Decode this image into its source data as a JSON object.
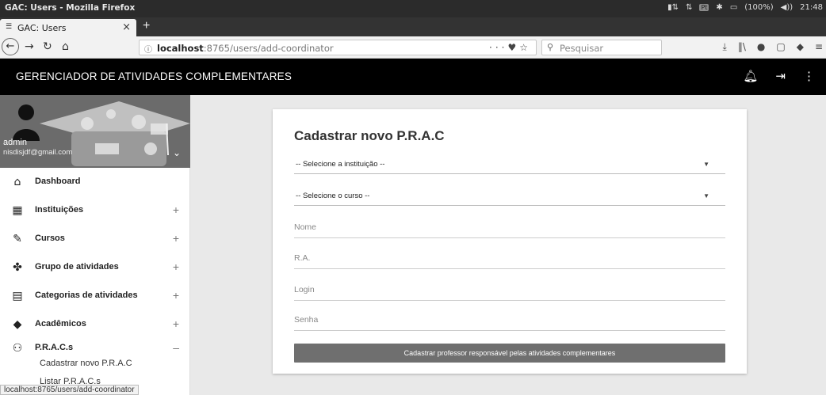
{
  "window": {
    "title": "GAC: Users - Mozilla Firefox"
  },
  "system_tray": {
    "indicator": "Pt",
    "battery": "(100%)",
    "volume_icon": "◀))",
    "clock": "21:48"
  },
  "browser": {
    "tab_label": "GAC: Users",
    "new_tab": "+",
    "url_host": "localhost",
    "url_rest": ":8765/users/add-coordinator",
    "search_placeholder": "Pesquisar",
    "status_link": "localhost:8765/users/add-coordinator"
  },
  "app": {
    "title": "GERENCIADOR DE ATIVIDADES COMPLEMENTARES"
  },
  "profile": {
    "name": "admin",
    "email": "nisdisjdf@gmail.com"
  },
  "sidebar": {
    "items": [
      {
        "label": "Dashboard",
        "icon": "home-icon",
        "expander": ""
      },
      {
        "label": "Instituições",
        "icon": "building-icon",
        "expander": "+"
      },
      {
        "label": "Cursos",
        "icon": "pencil-icon",
        "expander": "+"
      },
      {
        "label": "Grupo de atividades",
        "icon": "puzzle-icon",
        "expander": "+"
      },
      {
        "label": "Categorias de atividades",
        "icon": "clipboard-icon",
        "expander": "+"
      },
      {
        "label": "Acadêmicos",
        "icon": "graduation-cap-icon",
        "expander": "+"
      },
      {
        "label": "P.R.A.C.s",
        "icon": "people-icon",
        "expander": "–"
      }
    ],
    "submenu": [
      "Cadastrar novo P.R.A.C",
      "Listar P.R.A.C.s"
    ]
  },
  "form": {
    "title": "Cadastrar novo P.R.A.C",
    "institution_select": "-- Selecione a instituição --",
    "course_select": "-- Selecione o curso --",
    "name_placeholder": "Nome",
    "ra_placeholder": "R.A.",
    "login_placeholder": "Login",
    "password_placeholder": "Senha",
    "submit_label": "Cadastrar professor responsável pelas atividades complementares"
  }
}
